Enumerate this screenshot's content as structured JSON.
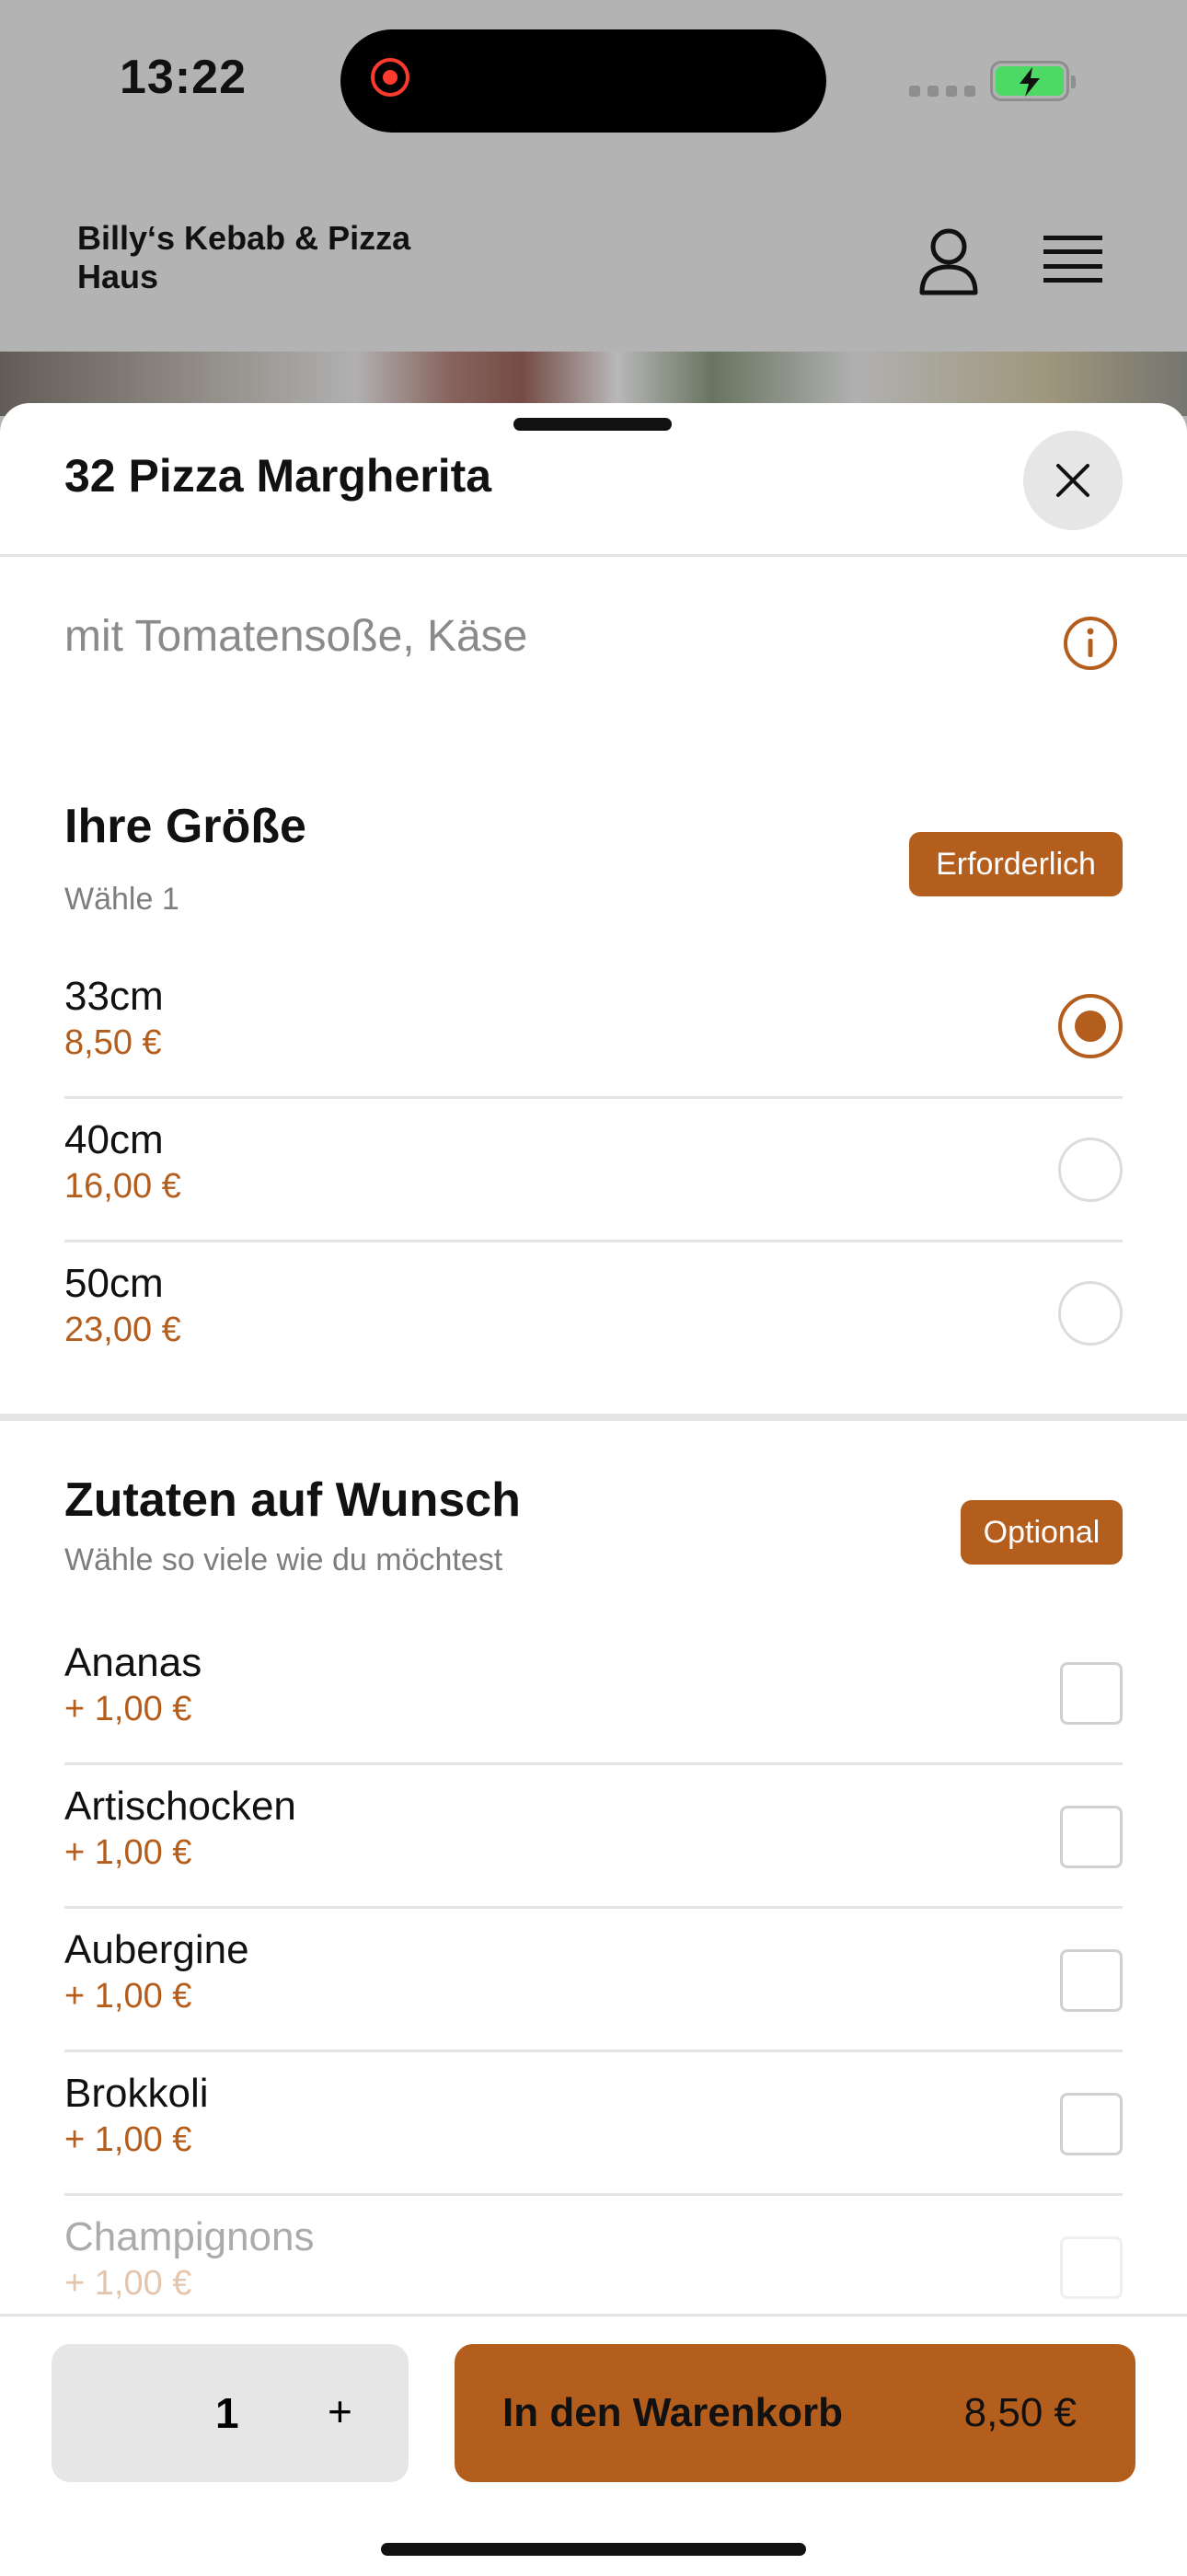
{
  "status_bar": {
    "time": "13:22"
  },
  "header": {
    "restaurant_name": "Billy‘s Kebab & Pizza Haus"
  },
  "item": {
    "title": "32 Pizza Margherita",
    "description": "mit Tomatensoße, Käse"
  },
  "size_section": {
    "title": "Ihre Größe",
    "subtitle": "Wähle 1",
    "badge": "Erforderlich",
    "options": [
      {
        "name": "33cm",
        "price": "8,50 €",
        "selected": true
      },
      {
        "name": "40cm",
        "price": "16,00 €",
        "selected": false
      },
      {
        "name": "50cm",
        "price": "23,00 €",
        "selected": false
      }
    ]
  },
  "extras_section": {
    "title": "Zutaten auf Wunsch",
    "subtitle": "Wähle so viele wie du möchtest",
    "badge": "Optional",
    "options": [
      {
        "name": "Ananas",
        "price": "+ 1,00 €",
        "checked": false
      },
      {
        "name": "Artischocken",
        "price": "+ 1,00 €",
        "checked": false
      },
      {
        "name": "Aubergine",
        "price": "+ 1,00 €",
        "checked": false
      },
      {
        "name": "Brokkoli",
        "price": "+ 1,00 €",
        "checked": false
      },
      {
        "name": "Champignons",
        "price": "+ 1,00 €",
        "checked": false
      }
    ]
  },
  "bottom_bar": {
    "quantity": "1",
    "plus_label": "+",
    "cart_label": "In den Warenkorb",
    "cart_price": "8,50 €"
  },
  "colors": {
    "accent": "#b45e1e",
    "overlay": "#b3b3b3",
    "divider": "#e4e4e4"
  },
  "icons": [
    "record-icon",
    "signal-icon",
    "battery-icon",
    "user-icon",
    "menu-icon",
    "close-icon",
    "info-icon"
  ]
}
